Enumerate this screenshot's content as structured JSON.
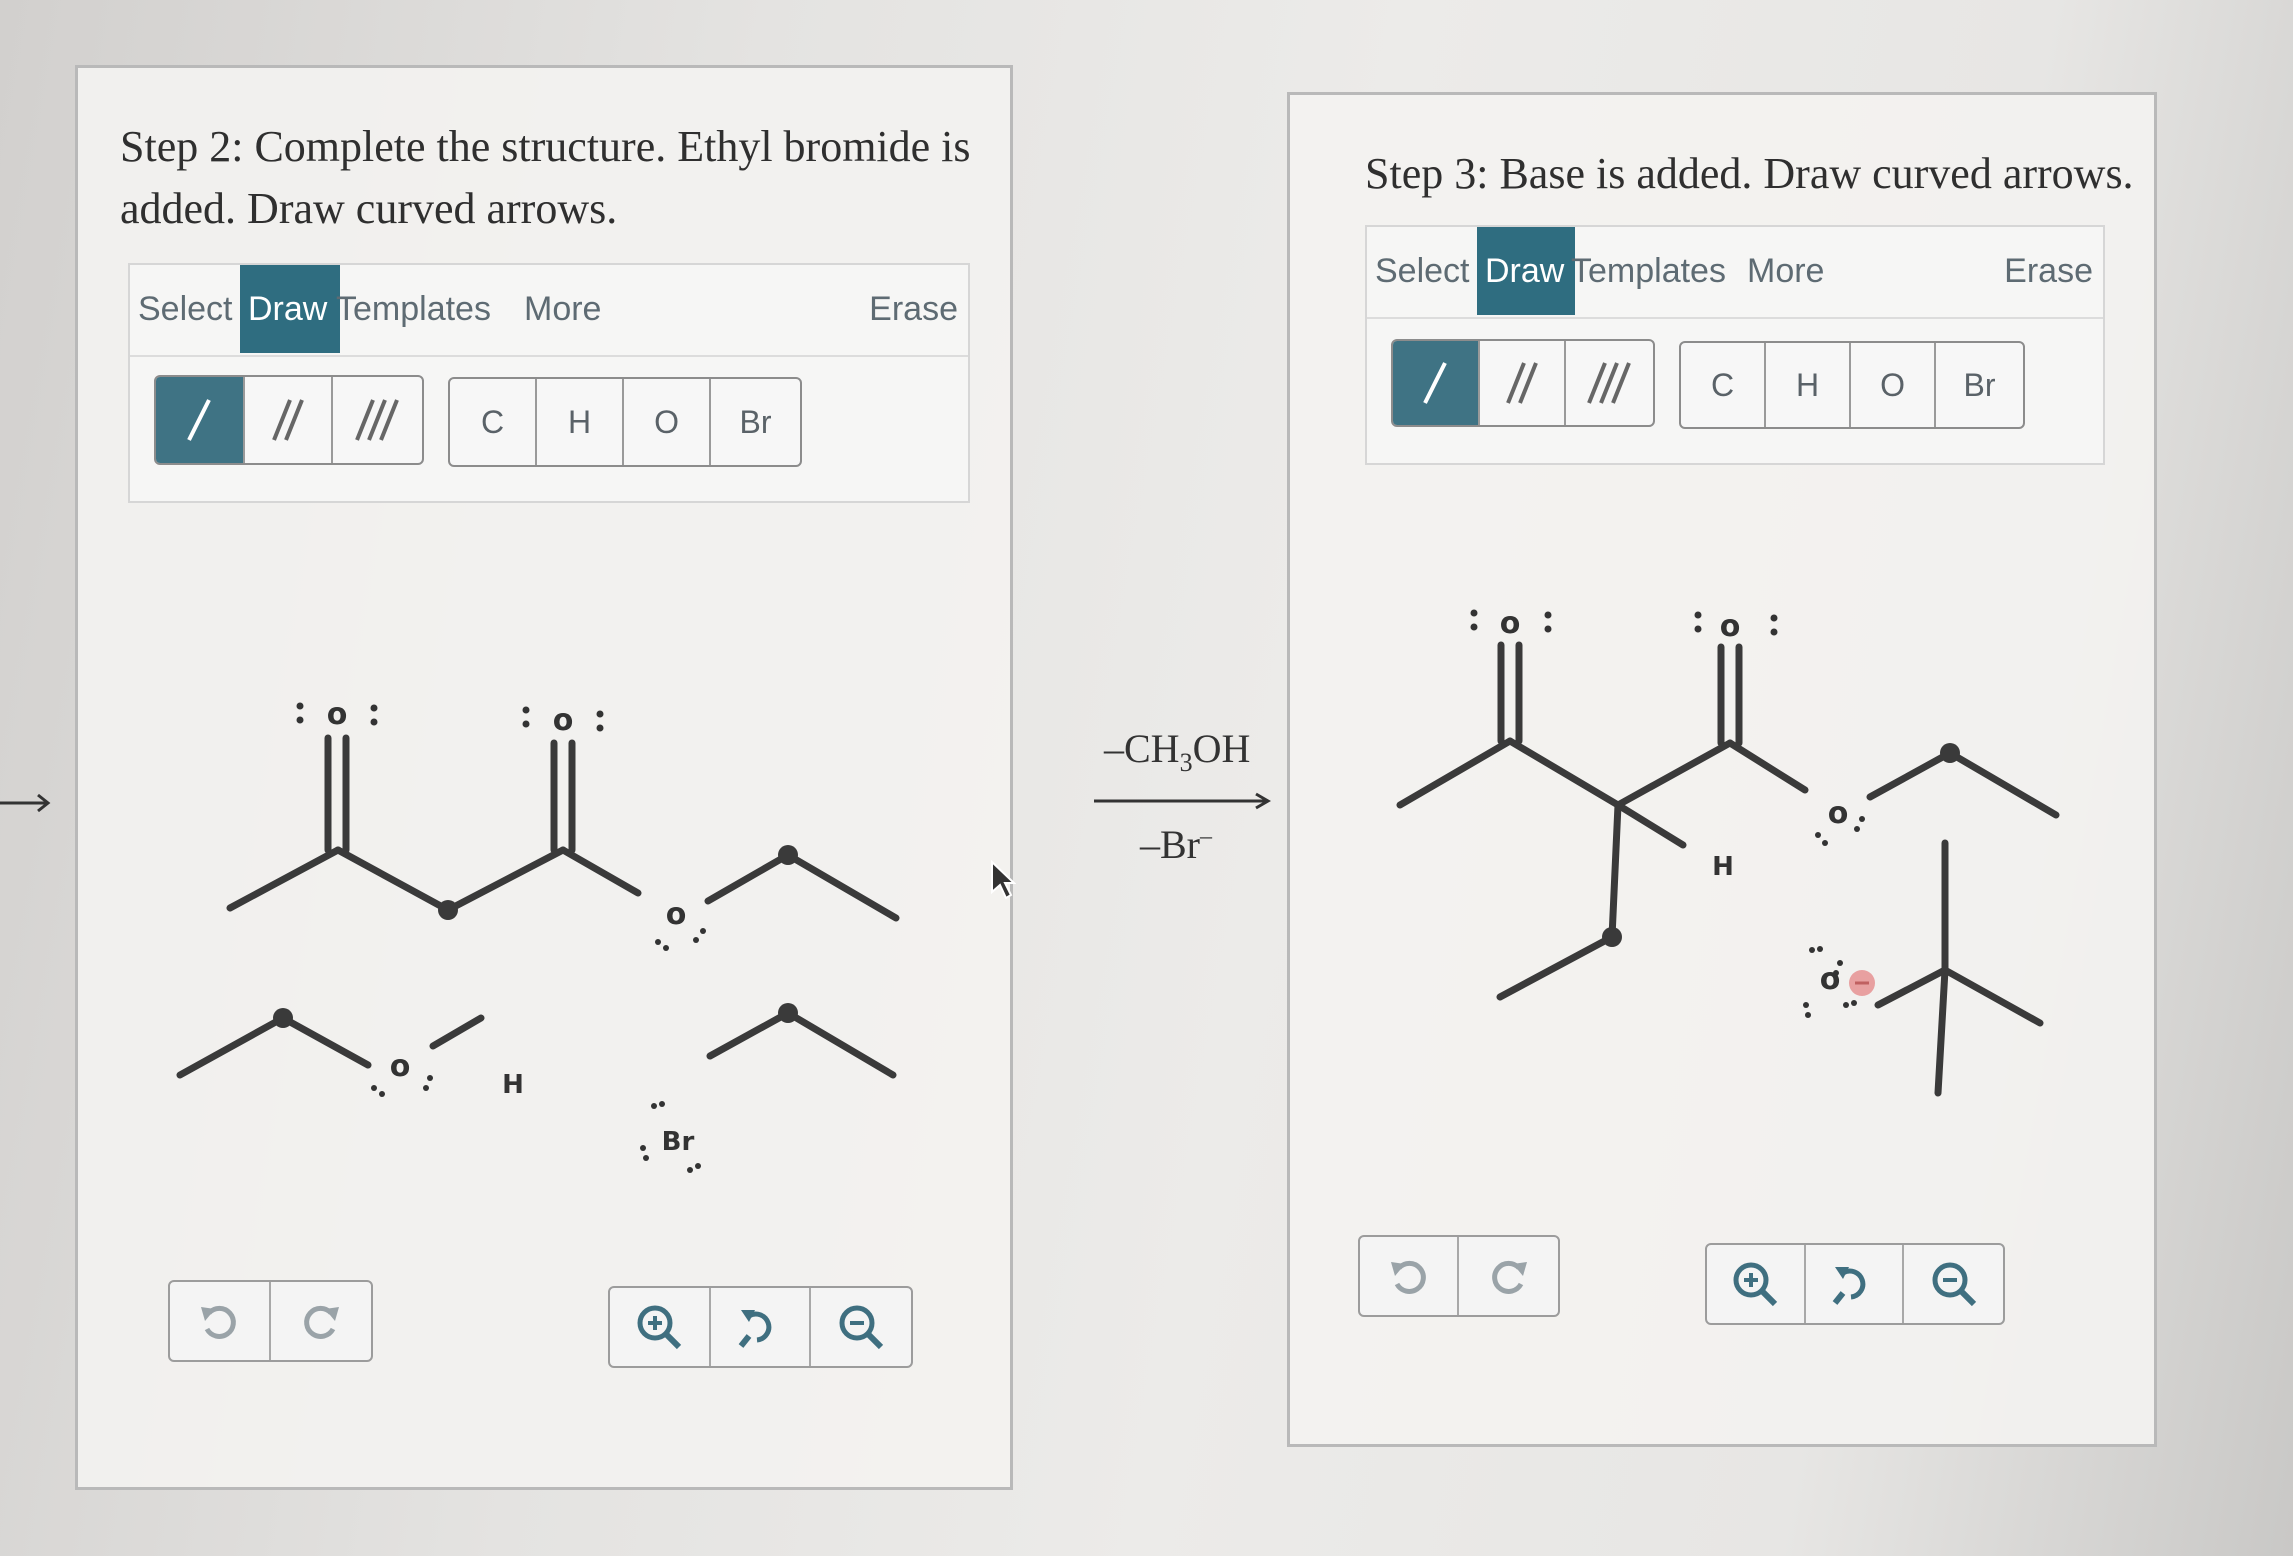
{
  "step2": {
    "title_line1": "Step 2: Complete the structure. Ethyl bromide is",
    "title_line2": "added. Draw curved arrows.",
    "tabs": [
      "Select",
      "Draw",
      "Templates",
      "More"
    ],
    "active_tab": "Draw",
    "erase_label": "Erase",
    "bond_tools": [
      "single-bond",
      "double-bond",
      "triple-bond"
    ],
    "atoms": [
      "C",
      "H",
      "O",
      "Br"
    ],
    "canvas_labels": {
      "o1": "o",
      "o2": "o",
      "o3": "o",
      "o4": "o",
      "h1": "H",
      "br": "Br"
    }
  },
  "step3": {
    "title": "Step 3: Base is added. Draw curved arrows.",
    "tabs": [
      "Select",
      "Draw",
      "Templates",
      "More"
    ],
    "active_tab": "Draw",
    "erase_label": "Erase",
    "bond_tools": [
      "single-bond",
      "double-bond",
      "triple-bond"
    ],
    "atoms": [
      "C",
      "H",
      "O",
      "Br"
    ],
    "canvas_labels": {
      "o1": "o",
      "o2": "o",
      "o3": "o",
      "o4": "o",
      "h1": "H"
    }
  },
  "reaction_arrow": {
    "top_prefix": "–CH",
    "top_sub": "3",
    "top_suffix": "OH",
    "bottom_prefix": "–Br",
    "bottom_sup": "–"
  },
  "controls": [
    "undo-icon",
    "redo-icon",
    "zoom-in-icon",
    "reset-zoom-icon",
    "zoom-out-icon"
  ],
  "colors": {
    "accent": "#2f6d80",
    "bond": "#3a3a3a",
    "negative_charge": "#e8a0a0"
  }
}
